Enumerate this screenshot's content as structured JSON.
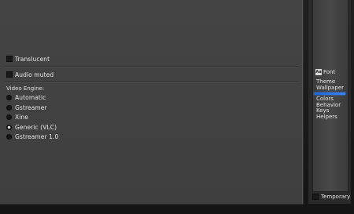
{
  "options": {
    "translucent_label": "Translucent",
    "audio_muted_label": "Audio muted"
  },
  "video_engine": {
    "label": "Video Engine:",
    "choices": [
      "Automatic",
      "Gstreamer",
      "Xine",
      "Generic (VLC)",
      "Gstreamer 1.0"
    ],
    "selected": "Generic (VLC)"
  },
  "sidebar": {
    "font_label": "Font",
    "font_icon_text": "Aa",
    "items": [
      "Theme",
      "Wallpaper",
      "Colors",
      "Behavior",
      "Keys",
      "Helpers"
    ],
    "active_item": "Wallpaper",
    "temporary_label": "Temporary",
    "accent_color": "#2f7be8"
  }
}
